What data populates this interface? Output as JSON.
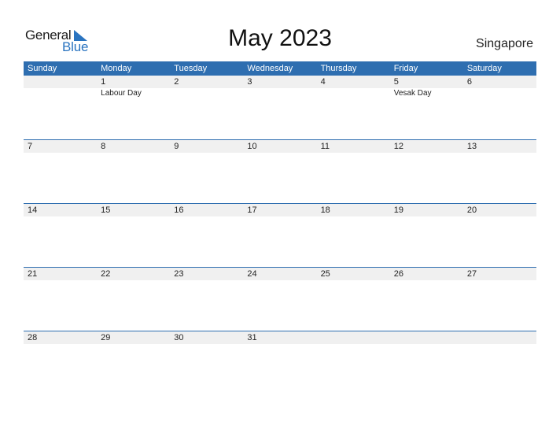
{
  "logo": {
    "line1": "General",
    "line2": "Blue"
  },
  "title": "May 2023",
  "country": "Singapore",
  "colors": {
    "accent": "#2e6eb0",
    "band": "#f0f0f0"
  },
  "weekdays": [
    "Sunday",
    "Monday",
    "Tuesday",
    "Wednesday",
    "Thursday",
    "Friday",
    "Saturday"
  ],
  "weeks": [
    [
      {
        "day": "",
        "holiday": ""
      },
      {
        "day": "1",
        "holiday": "Labour Day"
      },
      {
        "day": "2",
        "holiday": ""
      },
      {
        "day": "3",
        "holiday": ""
      },
      {
        "day": "4",
        "holiday": ""
      },
      {
        "day": "5",
        "holiday": "Vesak Day"
      },
      {
        "day": "6",
        "holiday": ""
      }
    ],
    [
      {
        "day": "7",
        "holiday": ""
      },
      {
        "day": "8",
        "holiday": ""
      },
      {
        "day": "9",
        "holiday": ""
      },
      {
        "day": "10",
        "holiday": ""
      },
      {
        "day": "11",
        "holiday": ""
      },
      {
        "day": "12",
        "holiday": ""
      },
      {
        "day": "13",
        "holiday": ""
      }
    ],
    [
      {
        "day": "14",
        "holiday": ""
      },
      {
        "day": "15",
        "holiday": ""
      },
      {
        "day": "16",
        "holiday": ""
      },
      {
        "day": "17",
        "holiday": ""
      },
      {
        "day": "18",
        "holiday": ""
      },
      {
        "day": "19",
        "holiday": ""
      },
      {
        "day": "20",
        "holiday": ""
      }
    ],
    [
      {
        "day": "21",
        "holiday": ""
      },
      {
        "day": "22",
        "holiday": ""
      },
      {
        "day": "23",
        "holiday": ""
      },
      {
        "day": "24",
        "holiday": ""
      },
      {
        "day": "25",
        "holiday": ""
      },
      {
        "day": "26",
        "holiday": ""
      },
      {
        "day": "27",
        "holiday": ""
      }
    ],
    [
      {
        "day": "28",
        "holiday": ""
      },
      {
        "day": "29",
        "holiday": ""
      },
      {
        "day": "30",
        "holiday": ""
      },
      {
        "day": "31",
        "holiday": ""
      },
      {
        "day": "",
        "holiday": ""
      },
      {
        "day": "",
        "holiday": ""
      },
      {
        "day": "",
        "holiday": ""
      }
    ]
  ]
}
